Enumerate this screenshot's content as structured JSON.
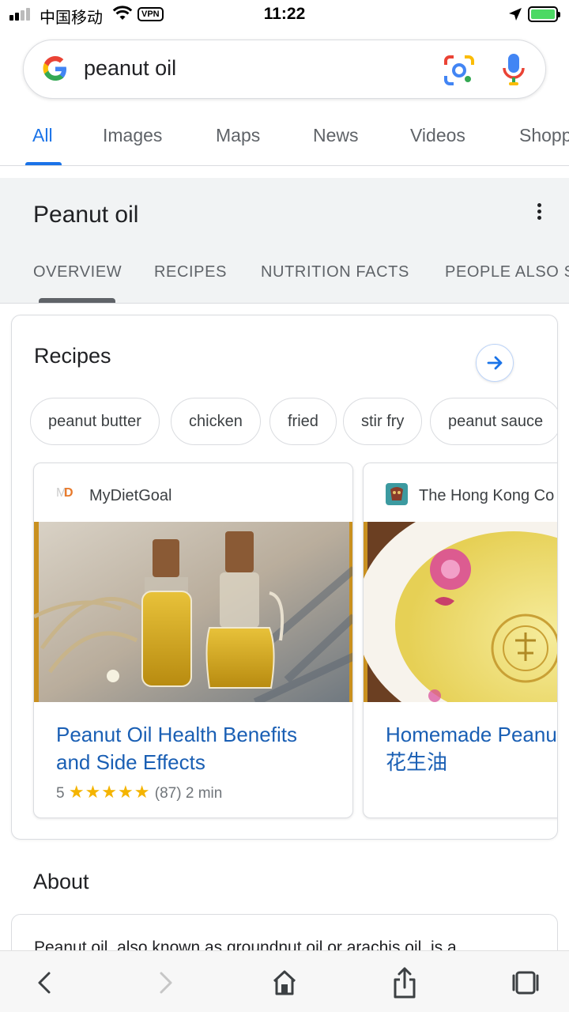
{
  "status_bar": {
    "carrier": "中国移动",
    "vpn": "VPN",
    "time": "11:22"
  },
  "search": {
    "query": "peanut oil"
  },
  "tabs": [
    "All",
    "Images",
    "Maps",
    "News",
    "Videos",
    "Shopp"
  ],
  "knowledge": {
    "title": "Peanut oil",
    "tabs": [
      "OVERVIEW",
      "RECIPES",
      "NUTRITION FACTS",
      "PEOPLE ALSO S"
    ]
  },
  "recipes": {
    "title": "Recipes",
    "chips": [
      "peanut butter",
      "chicken",
      "fried",
      "stir fry",
      "peanut sauce"
    ],
    "cards": [
      {
        "source": "MyDietGoal",
        "title_line1": "Peanut Oil Health Benefits",
        "title_line2": "and Side Effects",
        "rating": "5",
        "stars": "★★★★★",
        "reviews": "(87)",
        "time": "2 min"
      },
      {
        "source": "The Hong Kong Co",
        "title_line1": "Homemade Peanu",
        "title_line2": "花生油"
      }
    ]
  },
  "about": {
    "title": "About",
    "text": "Peanut oil, also known as groundnut oil or arachis oil, is a"
  },
  "colors": {
    "accent": "#1a73e8",
    "link": "#1a5fb4",
    "star": "#f4b400"
  }
}
